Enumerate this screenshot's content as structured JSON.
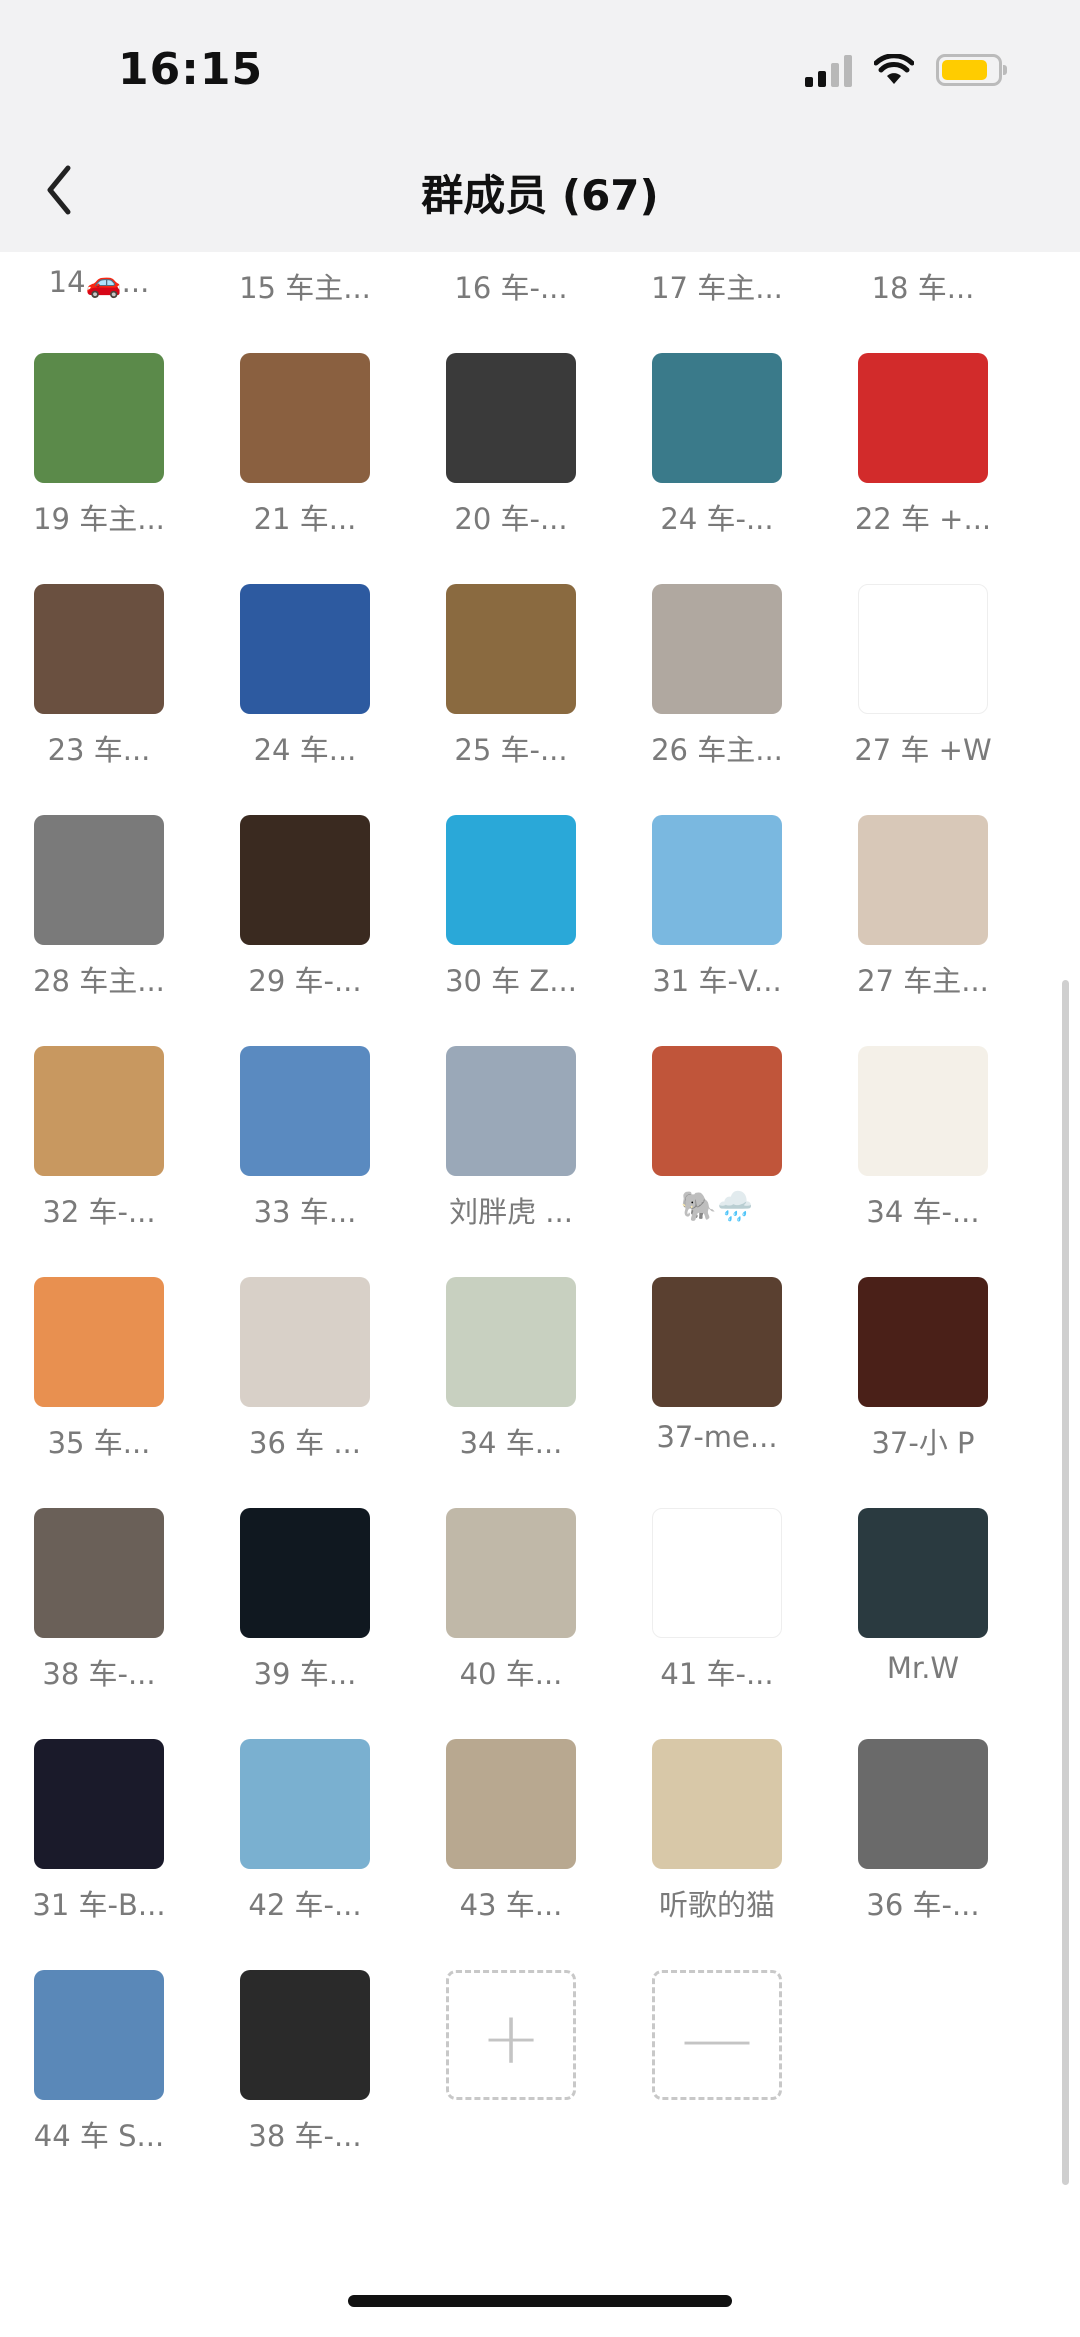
{
  "status_bar": {
    "time": "16:15",
    "battery_color": "#ffcc00",
    "battery_level": 0.85
  },
  "header": {
    "title": "群成员 (67)"
  },
  "members": [
    {
      "name": "14🚗...",
      "icon": "avatar-photo",
      "color": "#1e3a7a"
    },
    {
      "name": "15 车主...",
      "icon": "avatar-photo",
      "color": "#52c27a"
    },
    {
      "name": "16 车-...",
      "icon": "avatar-photo",
      "color": "#6aa6d8"
    },
    {
      "name": "17 车主...",
      "icon": "avatar-photo",
      "color": "#b07040"
    },
    {
      "name": "18 车...",
      "icon": "avatar-photo",
      "color": "#8a97a6"
    },
    {
      "name": "19 车主...",
      "icon": "avatar-photo",
      "color": "#5b8a4a"
    },
    {
      "name": "21 车...",
      "icon": "avatar-photo",
      "color": "#8a6040"
    },
    {
      "name": "20 车-...",
      "icon": "avatar-photo",
      "color": "#3a3a3a"
    },
    {
      "name": "24 车-...",
      "icon": "avatar-photo",
      "color": "#3a7a8a"
    },
    {
      "name": "22 车 +...",
      "icon": "avatar-photo",
      "color": "#d22b2b"
    },
    {
      "name": "23 车...",
      "icon": "avatar-photo",
      "color": "#6a5040"
    },
    {
      "name": "24 车...",
      "icon": "avatar-photo",
      "color": "#2d5aa0"
    },
    {
      "name": "25 车-...",
      "icon": "avatar-photo",
      "color": "#8a6a40"
    },
    {
      "name": "26 车主...",
      "icon": "avatar-photo",
      "color": "#b0a8a0"
    },
    {
      "name": "27 车 +W",
      "icon": "avatar-photo",
      "color": "#ffffff"
    },
    {
      "name": "28 车主...",
      "icon": "avatar-photo",
      "color": "#7a7a7a"
    },
    {
      "name": "29 车-...",
      "icon": "avatar-photo",
      "color": "#3a2a20"
    },
    {
      "name": "30 车 Z...",
      "icon": "avatar-photo",
      "color": "#2aa8d8"
    },
    {
      "name": "31 车-V...",
      "icon": "avatar-photo",
      "color": "#7ab8e0"
    },
    {
      "name": "27 车主...",
      "icon": "avatar-photo",
      "color": "#d8c8b8"
    },
    {
      "name": "32 车-...",
      "icon": "avatar-photo",
      "color": "#c89860"
    },
    {
      "name": "33 车...",
      "icon": "avatar-photo",
      "color": "#5a8ac0"
    },
    {
      "name": "刘胖虎 ...",
      "icon": "avatar-photo",
      "color": "#9aa8b8"
    },
    {
      "name": "🐘🌧️",
      "icon": "avatar-photo",
      "color": "#c0553a"
    },
    {
      "name": "34 车-...",
      "icon": "avatar-photo",
      "color": "#f4f0e8"
    },
    {
      "name": "35 车...",
      "icon": "avatar-photo",
      "color": "#e89050"
    },
    {
      "name": "36 车 ...",
      "icon": "avatar-photo",
      "color": "#d8d0c8"
    },
    {
      "name": "34 车...",
      "icon": "avatar-photo",
      "color": "#c8d0c0"
    },
    {
      "name": "37-me...",
      "icon": "avatar-photo",
      "color": "#5a4030"
    },
    {
      "name": "37-小 P",
      "icon": "avatar-photo",
      "color": "#4a2018"
    },
    {
      "name": "38 车-...",
      "icon": "avatar-photo",
      "color": "#6a6058"
    },
    {
      "name": "39 车...",
      "icon": "avatar-photo",
      "color": "#101820"
    },
    {
      "name": "40 车...",
      "icon": "avatar-photo",
      "color": "#c0b8a8"
    },
    {
      "name": "41 车-...",
      "icon": "avatar-photo",
      "color": "#ffffff"
    },
    {
      "name": "Mr.W",
      "icon": "avatar-photo",
      "color": "#2a3a40"
    },
    {
      "name": "31 车-B...",
      "icon": "avatar-photo",
      "color": "#1a1a2a"
    },
    {
      "name": "42 车-...",
      "icon": "avatar-photo",
      "color": "#7ab0d0"
    },
    {
      "name": "43 车...",
      "icon": "avatar-photo",
      "color": "#b8a890"
    },
    {
      "name": "听歌的猫",
      "icon": "avatar-photo",
      "color": "#d8c8a8"
    },
    {
      "name": "36 车-...",
      "icon": "avatar-photo",
      "color": "#6a6a6a"
    },
    {
      "name": "44 车 S...",
      "icon": "avatar-photo",
      "color": "#5a88b8"
    },
    {
      "name": "38 车-...",
      "icon": "avatar-photo",
      "color": "#2a2a2a"
    }
  ],
  "actions": {
    "add": {
      "glyph": "+",
      "icon": "plus-icon"
    },
    "remove": {
      "glyph": "—",
      "icon": "minus-icon"
    }
  }
}
